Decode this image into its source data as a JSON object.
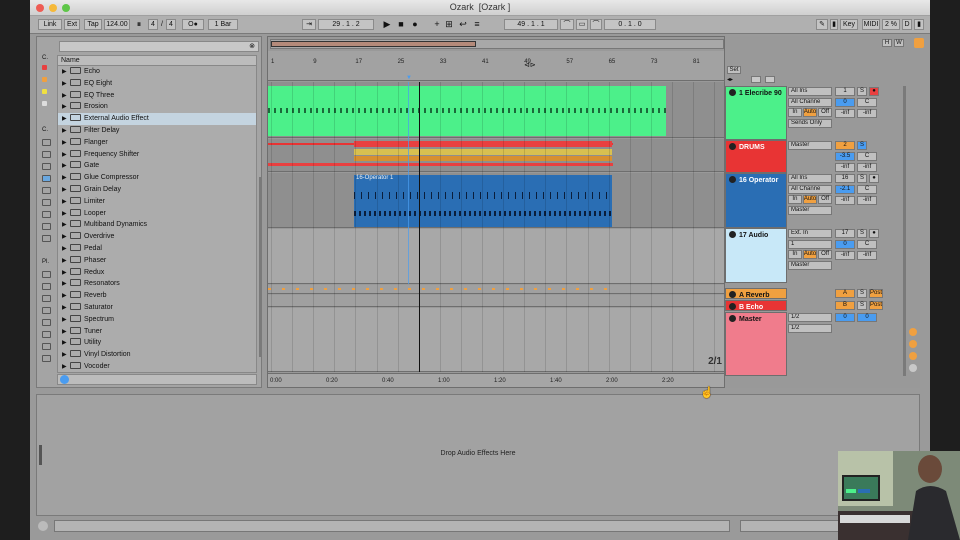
{
  "window": {
    "title": "Ozark",
    "doc": "[Ozark ]"
  },
  "transport": {
    "link": "Link",
    "ext": "Ext",
    "tap": "Tap",
    "tempo": "124.00",
    "sig_num": "4",
    "sig_slash": "/",
    "sig_den": "4",
    "quantize": "1 Bar",
    "metronome": "O●",
    "position": "29 .  1 .  2",
    "loop_start": "49 .  1 .  1",
    "loop_len": "0 .  1 .  0",
    "key": "Key",
    "midi": "MIDI",
    "cpu": "2 %",
    "d_label": "D",
    "h_label": "H",
    "w_label": "W"
  },
  "browser": {
    "header": "Name",
    "items": [
      {
        "label": "Echo",
        "selected": false
      },
      {
        "label": "EQ Eight",
        "selected": false
      },
      {
        "label": "EQ Three",
        "selected": false
      },
      {
        "label": "Erosion",
        "selected": false
      },
      {
        "label": "External Audio Effect",
        "selected": true
      },
      {
        "label": "Filter Delay",
        "selected": false
      },
      {
        "label": "Flanger",
        "selected": false
      },
      {
        "label": "Frequency Shifter",
        "selected": false
      },
      {
        "label": "Gate",
        "selected": false
      },
      {
        "label": "Glue Compressor",
        "selected": false
      },
      {
        "label": "Grain Delay",
        "selected": false
      },
      {
        "label": "Limiter",
        "selected": false
      },
      {
        "label": "Looper",
        "selected": false
      },
      {
        "label": "Multiband Dynamics",
        "selected": false
      },
      {
        "label": "Overdrive",
        "selected": false
      },
      {
        "label": "Pedal",
        "selected": false
      },
      {
        "label": "Phaser",
        "selected": false
      },
      {
        "label": "Redux",
        "selected": false
      },
      {
        "label": "Resonators",
        "selected": false
      },
      {
        "label": "Reverb",
        "selected": false
      },
      {
        "label": "Saturator",
        "selected": false
      },
      {
        "label": "Spectrum",
        "selected": false
      },
      {
        "label": "Tuner",
        "selected": false
      },
      {
        "label": "Utility",
        "selected": false
      },
      {
        "label": "Vinyl Distortion",
        "selected": false
      },
      {
        "label": "Vocoder",
        "selected": false
      }
    ],
    "side_labels": {
      "cats": "C.",
      "cats2": "C.",
      "places": "Pl."
    }
  },
  "ruler": {
    "bars": [
      "1",
      "9",
      "17",
      "25",
      "33",
      "41",
      "49",
      "57",
      "65",
      "73",
      "81"
    ],
    "set_label": "Set"
  },
  "timebar": {
    "times": [
      "0:00",
      "0:20",
      "0:40",
      "1:00",
      "1:20",
      "1:40",
      "2:00",
      "2:20"
    ],
    "page": "2/1"
  },
  "tracks": [
    {
      "name": "1 Elecribe 90",
      "color": "#4cf08a",
      "io": [
        "All Ins",
        "All Channe",
        "Sends Only"
      ],
      "track_no": "1",
      "vol": "0",
      "pan": "C",
      "sends": [
        "-inf",
        "-inf"
      ]
    },
    {
      "name": "DRUMS",
      "color": "#e83434",
      "io": [
        "Master"
      ],
      "track_no": "2",
      "vol": "-3.5",
      "pan": "C",
      "sends": [
        "-inf",
        "-inf"
      ]
    },
    {
      "name": "16 Operator",
      "color": "#2a6eb4",
      "clip": "16-Operator 1",
      "io": [
        "All Ins",
        "All Channe",
        "Master"
      ],
      "track_no": "16",
      "vol": "-2.1",
      "pan": "C",
      "sends": [
        "-inf",
        "-inf"
      ]
    },
    {
      "name": "17 Audio",
      "color": "#c8e8f8",
      "io": [
        "Ext. In",
        "1",
        "Master"
      ],
      "track_no": "17",
      "vol": "0",
      "pan": "C",
      "sends": [
        "-inf",
        "-inf"
      ]
    }
  ],
  "returns": [
    {
      "name": "A Reverb",
      "color": "#f0a040",
      "letter": "A",
      "mode": "Post"
    },
    {
      "name": "B Echo",
      "color": "#e83434",
      "letter": "B",
      "mode": "Post"
    }
  ],
  "master": {
    "name": "Master",
    "color": "#f07c8c",
    "io": [
      "1/2",
      "1/2"
    ],
    "vol": "0",
    "pan": "0"
  },
  "monitor": {
    "in": "In",
    "auto": "Auto",
    "off": "Off"
  },
  "solo": "S",
  "devices": {
    "drop_text": "Drop Audio Effects Here"
  }
}
